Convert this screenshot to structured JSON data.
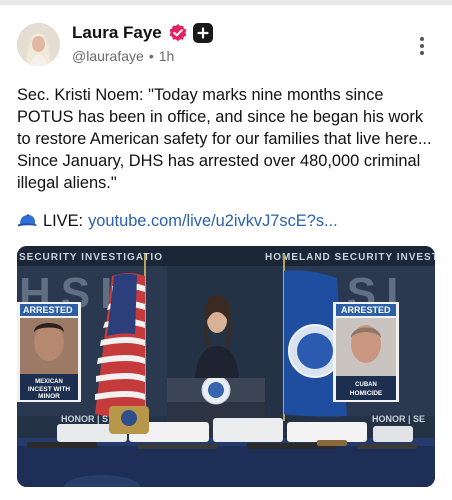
{
  "post": {
    "author": {
      "name": "Laura Faye",
      "handle": "@laurafaye",
      "separator": "•",
      "time": "1h",
      "verified_icon": "verified-badge-icon",
      "subscribe_icon": "plus-icon",
      "avatar_icon": "avatar"
    },
    "text": "Sec. Kristi Noem: \"Today marks nine months since POTUS has been in office, and since he began his work to restore American safety for our families that live here... Since January, DHS has arrested over 480,000 criminal illegal aliens.\"",
    "live": {
      "icon": "cap-icon",
      "label": "LIVE:",
      "link_text": "youtube.com/live/u2ivkvJ7scE?s..."
    },
    "menu_icon": "more-vertical-icon",
    "media": {
      "banner_left": "SECURITY INVESTIGATIO",
      "banner_right": "HOMELAND SECURITY INVESTI",
      "hsi_left": "HSI",
      "hsi_right": "HSI",
      "poster_left": {
        "tag": "ARRESTED",
        "line1": "MEXICAN",
        "line2": "INCEST WITH",
        "line3": "MINOR"
      },
      "poster_right": {
        "tag": "ARRESTED",
        "line1": "CUBAN",
        "line2": "HOMICIDE"
      },
      "honor_left": "HONOR | S",
      "honor_right": "HONOR | SE"
    }
  },
  "colors": {
    "link": "#2a5fb0",
    "verified": "#e0245e",
    "backdrop": "#1f2b3c",
    "poster_tag": "#2d5fa8"
  }
}
